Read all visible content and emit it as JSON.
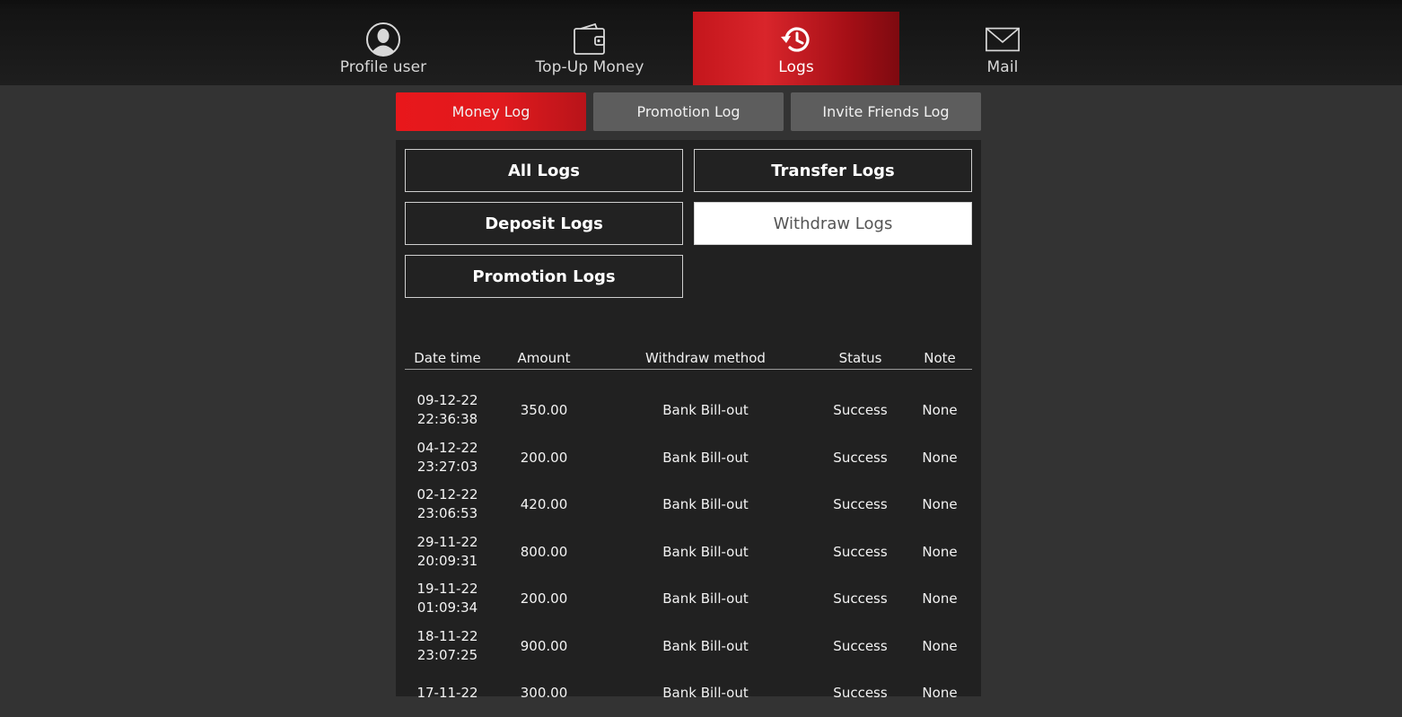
{
  "nav": {
    "items": [
      {
        "label": "Profile user",
        "icon": "user-avatar-icon",
        "active": false
      },
      {
        "label": "Top-Up Money",
        "icon": "wallet-icon",
        "active": false
      },
      {
        "label": "Logs",
        "icon": "history-icon",
        "active": true
      },
      {
        "label": "Mail",
        "icon": "mail-icon",
        "active": false
      }
    ]
  },
  "subtabs": [
    {
      "label": "Money Log",
      "active": true
    },
    {
      "label": "Promotion Log",
      "active": false
    },
    {
      "label": "Invite Friends Log",
      "active": false
    }
  ],
  "filters": {
    "all": "All Logs",
    "transfer": "Transfer Logs",
    "deposit": "Deposit Logs",
    "withdraw": "Withdraw Logs",
    "promotion": "Promotion Logs",
    "selected": "Withdraw Logs"
  },
  "table": {
    "headers": {
      "datetime": "Date time",
      "amount": "Amount",
      "method": "Withdraw method",
      "status": "Status",
      "note": "Note"
    },
    "rows": [
      {
        "date": "09-12-22",
        "time": "22:36:38",
        "amount": "350.00",
        "method": "Bank Bill-out",
        "status": "Success",
        "note": "None"
      },
      {
        "date": "04-12-22",
        "time": "23:27:03",
        "amount": "200.00",
        "method": "Bank Bill-out",
        "status": "Success",
        "note": "None"
      },
      {
        "date": "02-12-22",
        "time": "23:06:53",
        "amount": "420.00",
        "method": "Bank Bill-out",
        "status": "Success",
        "note": "None"
      },
      {
        "date": "29-11-22",
        "time": "20:09:31",
        "amount": "800.00",
        "method": "Bank Bill-out",
        "status": "Success",
        "note": "None"
      },
      {
        "date": "19-11-22",
        "time": "01:09:34",
        "amount": "200.00",
        "method": "Bank Bill-out",
        "status": "Success",
        "note": "None"
      },
      {
        "date": "18-11-22",
        "time": "23:07:25",
        "amount": "900.00",
        "method": "Bank Bill-out",
        "status": "Success",
        "note": "None"
      },
      {
        "date": "17-11-22",
        "time": "",
        "amount": "300.00",
        "method": "Bank Bill-out",
        "status": "Success",
        "note": "None"
      }
    ]
  },
  "colors": {
    "accent_red": "#e8171b",
    "background": "#333333",
    "panel": "#212121"
  }
}
